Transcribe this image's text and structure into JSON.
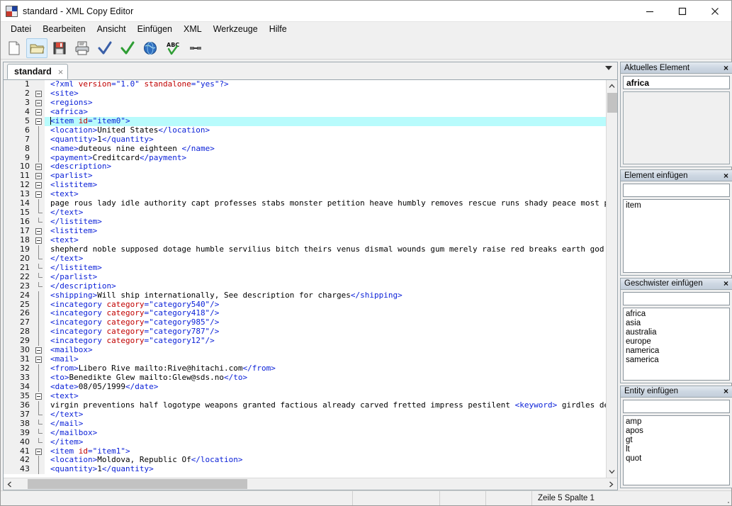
{
  "window": {
    "title": "standard - XML Copy Editor",
    "icon": "app-logo-icon",
    "minimize": "minimize-icon",
    "maximize": "maximize-icon",
    "close": "close-icon"
  },
  "menubar": {
    "items": [
      {
        "label": "Datei"
      },
      {
        "label": "Bearbeiten"
      },
      {
        "label": "Ansicht"
      },
      {
        "label": "Einfügen"
      },
      {
        "label": "XML"
      },
      {
        "label": "Werkzeuge"
      },
      {
        "label": "Hilfe"
      }
    ]
  },
  "toolbar": {
    "buttons": [
      {
        "name": "new-document-icon",
        "hovered": false
      },
      {
        "name": "open-folder-icon",
        "hovered": true
      },
      {
        "name": "save-disk-icon",
        "hovered": false
      },
      {
        "name": "print-icon",
        "hovered": false
      },
      {
        "name": "check-wellformed-icon",
        "hovered": false
      },
      {
        "name": "validate-icon",
        "hovered": false
      },
      {
        "name": "globe-preview-icon",
        "hovered": false
      },
      {
        "name": "spellcheck-abc-icon",
        "hovered": false
      },
      {
        "name": "link-icon",
        "hovered": false
      }
    ]
  },
  "tabs": [
    {
      "label": "standard",
      "close": "×",
      "active": true
    }
  ],
  "editor": {
    "selected_line": 5,
    "lines": [
      {
        "n": 1,
        "fold": "none",
        "indent": 0,
        "tokens": [
          {
            "t": "tg",
            "s": "<?xml "
          },
          {
            "t": "at",
            "s": "version"
          },
          {
            "t": "tg",
            "s": "=\"1.0\" "
          },
          {
            "t": "at",
            "s": "standalone"
          },
          {
            "t": "tg",
            "s": "=\"yes\"?>"
          }
        ]
      },
      {
        "n": 2,
        "fold": "open",
        "indent": 0,
        "tokens": [
          {
            "t": "tg",
            "s": "<site>"
          }
        ]
      },
      {
        "n": 3,
        "fold": "open",
        "indent": 0,
        "tokens": [
          {
            "t": "tg",
            "s": "<regions>"
          }
        ]
      },
      {
        "n": 4,
        "fold": "open",
        "indent": 0,
        "tokens": [
          {
            "t": "tg",
            "s": "<africa>"
          }
        ]
      },
      {
        "n": 5,
        "fold": "open",
        "indent": 0,
        "caret": true,
        "tokens": [
          {
            "t": "tg",
            "s": "<item "
          },
          {
            "t": "at",
            "s": "id"
          },
          {
            "t": "tg",
            "s": "=\"item0\">"
          }
        ]
      },
      {
        "n": 6,
        "fold": "line",
        "indent": 0,
        "tokens": [
          {
            "t": "tg",
            "s": "<location>"
          },
          {
            "t": "tx",
            "s": "United States"
          },
          {
            "t": "tg",
            "s": "</location>"
          }
        ]
      },
      {
        "n": 7,
        "fold": "line",
        "indent": 0,
        "tokens": [
          {
            "t": "tg",
            "s": "<quantity>"
          },
          {
            "t": "tx",
            "s": "1"
          },
          {
            "t": "tg",
            "s": "</quantity>"
          }
        ]
      },
      {
        "n": 8,
        "fold": "line",
        "indent": 0,
        "tokens": [
          {
            "t": "tg",
            "s": "<name>"
          },
          {
            "t": "tx",
            "s": "duteous nine eighteen "
          },
          {
            "t": "tg",
            "s": "</name>"
          }
        ]
      },
      {
        "n": 9,
        "fold": "line",
        "indent": 0,
        "tokens": [
          {
            "t": "tg",
            "s": "<payment>"
          },
          {
            "t": "tx",
            "s": "Creditcard"
          },
          {
            "t": "tg",
            "s": "</payment>"
          }
        ]
      },
      {
        "n": 10,
        "fold": "open",
        "indent": 0,
        "tokens": [
          {
            "t": "tg",
            "s": "<description>"
          }
        ]
      },
      {
        "n": 11,
        "fold": "open",
        "indent": 0,
        "tokens": [
          {
            "t": "tg",
            "s": "<parlist>"
          }
        ]
      },
      {
        "n": 12,
        "fold": "open",
        "indent": 0,
        "tokens": [
          {
            "t": "tg",
            "s": "<listitem>"
          }
        ]
      },
      {
        "n": 13,
        "fold": "open",
        "indent": 0,
        "tokens": [
          {
            "t": "tg",
            "s": "<text>"
          }
        ]
      },
      {
        "n": 14,
        "fold": "line",
        "indent": 0,
        "tokens": [
          {
            "t": "tx",
            "s": "page rous lady idle authority capt professes stabs monster petition heave humbly removes rescue runs shady peace most piteous worser oak assembly holes patience"
          }
        ]
      },
      {
        "n": 15,
        "fold": "end",
        "indent": 0,
        "tokens": [
          {
            "t": "tg",
            "s": "</text>"
          }
        ]
      },
      {
        "n": 16,
        "fold": "end",
        "indent": 0,
        "tokens": [
          {
            "t": "tg",
            "s": "</listitem>"
          }
        ]
      },
      {
        "n": 17,
        "fold": "open",
        "indent": 0,
        "tokens": [
          {
            "t": "tg",
            "s": "<listitem>"
          }
        ]
      },
      {
        "n": 18,
        "fold": "open",
        "indent": 0,
        "tokens": [
          {
            "t": "tg",
            "s": "<text>"
          }
        ]
      },
      {
        "n": 19,
        "fold": "line",
        "indent": 0,
        "tokens": [
          {
            "t": "tx",
            "s": "shepherd noble supposed dotage humble servilius bitch theirs venus dismal wounds gum merely raise red breaks earth god folds closet captain dying reek "
          }
        ]
      },
      {
        "n": 20,
        "fold": "end",
        "indent": 0,
        "tokens": [
          {
            "t": "tg",
            "s": "</text>"
          }
        ]
      },
      {
        "n": 21,
        "fold": "end",
        "indent": 0,
        "tokens": [
          {
            "t": "tg",
            "s": "</listitem>"
          }
        ]
      },
      {
        "n": 22,
        "fold": "end",
        "indent": 0,
        "tokens": [
          {
            "t": "tg",
            "s": "</parlist>"
          }
        ]
      },
      {
        "n": 23,
        "fold": "end",
        "indent": 0,
        "tokens": [
          {
            "t": "tg",
            "s": "</description>"
          }
        ]
      },
      {
        "n": 24,
        "fold": "line",
        "indent": 0,
        "tokens": [
          {
            "t": "tg",
            "s": "<shipping>"
          },
          {
            "t": "tx",
            "s": "Will ship internationally, See description for charges"
          },
          {
            "t": "tg",
            "s": "</shipping>"
          }
        ]
      },
      {
        "n": 25,
        "fold": "line",
        "indent": 0,
        "tokens": [
          {
            "t": "tg",
            "s": "<incategory "
          },
          {
            "t": "at",
            "s": "category"
          },
          {
            "t": "tg",
            "s": "=\"category540\"/>"
          }
        ]
      },
      {
        "n": 26,
        "fold": "line",
        "indent": 0,
        "tokens": [
          {
            "t": "tg",
            "s": "<incategory "
          },
          {
            "t": "at",
            "s": "category"
          },
          {
            "t": "tg",
            "s": "=\"category418\"/>"
          }
        ]
      },
      {
        "n": 27,
        "fold": "line",
        "indent": 0,
        "tokens": [
          {
            "t": "tg",
            "s": "<incategory "
          },
          {
            "t": "at",
            "s": "category"
          },
          {
            "t": "tg",
            "s": "=\"category985\"/>"
          }
        ]
      },
      {
        "n": 28,
        "fold": "line",
        "indent": 0,
        "tokens": [
          {
            "t": "tg",
            "s": "<incategory "
          },
          {
            "t": "at",
            "s": "category"
          },
          {
            "t": "tg",
            "s": "=\"category787\"/>"
          }
        ]
      },
      {
        "n": 29,
        "fold": "line",
        "indent": 0,
        "tokens": [
          {
            "t": "tg",
            "s": "<incategory "
          },
          {
            "t": "at",
            "s": "category"
          },
          {
            "t": "tg",
            "s": "=\"category12\"/>"
          }
        ]
      },
      {
        "n": 30,
        "fold": "open",
        "indent": 0,
        "tokens": [
          {
            "t": "tg",
            "s": "<mailbox>"
          }
        ]
      },
      {
        "n": 31,
        "fold": "open",
        "indent": 0,
        "tokens": [
          {
            "t": "tg",
            "s": "<mail>"
          }
        ]
      },
      {
        "n": 32,
        "fold": "line",
        "indent": 0,
        "tokens": [
          {
            "t": "tg",
            "s": "<from>"
          },
          {
            "t": "tx",
            "s": "Libero Rive mailto:Rive@hitachi.com"
          },
          {
            "t": "tg",
            "s": "</from>"
          }
        ]
      },
      {
        "n": 33,
        "fold": "line",
        "indent": 0,
        "tokens": [
          {
            "t": "tg",
            "s": "<to>"
          },
          {
            "t": "tx",
            "s": "Benedikte Glew mailto:Glew@sds.no"
          },
          {
            "t": "tg",
            "s": "</to>"
          }
        ]
      },
      {
        "n": 34,
        "fold": "line",
        "indent": 0,
        "tokens": [
          {
            "t": "tg",
            "s": "<date>"
          },
          {
            "t": "tx",
            "s": "08/05/1999"
          },
          {
            "t": "tg",
            "s": "</date>"
          }
        ]
      },
      {
        "n": 35,
        "fold": "open",
        "indent": 0,
        "tokens": [
          {
            "t": "tg",
            "s": "<text>"
          }
        ]
      },
      {
        "n": 36,
        "fold": "line",
        "indent": 0,
        "tokens": [
          {
            "t": "tx",
            "s": "virgin preventions half logotype weapons granted factious already carved fretted impress pestilent "
          },
          {
            "t": "tg",
            "s": "<keyword>"
          },
          {
            "t": "tx",
            "s": " girdles deserts flood george nobility reprieve "
          },
          {
            "t": "tg",
            "s": "</keyword>"
          }
        ]
      },
      {
        "n": 37,
        "fold": "end",
        "indent": 0,
        "tokens": [
          {
            "t": "tg",
            "s": "</text>"
          }
        ]
      },
      {
        "n": 38,
        "fold": "end",
        "indent": 0,
        "tokens": [
          {
            "t": "tg",
            "s": "</mail>"
          }
        ]
      },
      {
        "n": 39,
        "fold": "end",
        "indent": 0,
        "tokens": [
          {
            "t": "tg",
            "s": "</mailbox>"
          }
        ]
      },
      {
        "n": 40,
        "fold": "end",
        "indent": 0,
        "tokens": [
          {
            "t": "tg",
            "s": "</item>"
          }
        ]
      },
      {
        "n": 41,
        "fold": "open",
        "indent": 0,
        "tokens": [
          {
            "t": "tg",
            "s": "<item "
          },
          {
            "t": "at",
            "s": "id"
          },
          {
            "t": "tg",
            "s": "=\"item1\">"
          }
        ]
      },
      {
        "n": 42,
        "fold": "line",
        "indent": 0,
        "tokens": [
          {
            "t": "tg",
            "s": "<location>"
          },
          {
            "t": "tx",
            "s": "Moldova, Republic Of"
          },
          {
            "t": "tg",
            "s": "</location>"
          }
        ]
      },
      {
        "n": 43,
        "fold": "line",
        "indent": 0,
        "tokens": [
          {
            "t": "tg",
            "s": "<quantity>"
          },
          {
            "t": "tx",
            "s": "1"
          },
          {
            "t": "tg",
            "s": "</quantity>"
          }
        ]
      }
    ]
  },
  "sidebar": {
    "panels": [
      {
        "title": "Aktuelles Element",
        "close": "×",
        "field_value": "africa",
        "has_field": true,
        "has_list": false,
        "items": []
      },
      {
        "title": "Element einfügen",
        "close": "×",
        "field_value": "",
        "has_field": true,
        "has_list": true,
        "items": [
          "item"
        ]
      },
      {
        "title": "Geschwister einfügen",
        "close": "×",
        "field_value": "",
        "has_field": true,
        "has_list": true,
        "items": [
          "africa",
          "asia",
          "australia",
          "europe",
          "namerica",
          "samerica"
        ]
      },
      {
        "title": "Entity einfügen",
        "close": "×",
        "field_value": "",
        "has_field": true,
        "has_list": true,
        "items": [
          "amp",
          "apos",
          "gt",
          "lt",
          "quot"
        ]
      }
    ]
  },
  "statusbar": {
    "cell1": "",
    "cell2": "",
    "cell3": "",
    "cell4": "",
    "position": "Zeile 5 Spalte 1"
  },
  "colors": {
    "tag": "#0c22d8",
    "attribute": "#c00000",
    "text": "#000000",
    "selection": "#b8fbfc",
    "panel_header": "#cdd7e2"
  }
}
